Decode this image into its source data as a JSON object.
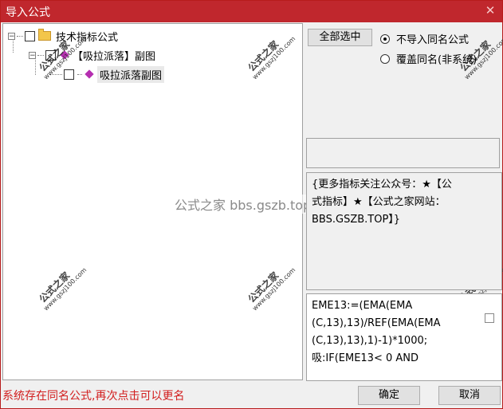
{
  "window": {
    "title": "导入公式",
    "close_glyph": "✕"
  },
  "tree": {
    "root_label": "技术指标公式",
    "child_label": "【吸拉派落】副图",
    "leaf_label": "吸拉派落副图"
  },
  "options": {
    "select_all_label": "全部选中",
    "radio_skip_label": "不导入同名公式",
    "radio_overwrite_label": "覆盖同名(非系统)",
    "selected_option": "不导入同名公式"
  },
  "description": {
    "lines": [
      "{更多指标关注公众号：★【公",
      "式指标】★【公式之家网站：",
      "BBS.GSZB.TOP】}"
    ]
  },
  "code": {
    "lines": [
      "EME13:=(EMA(EMA",
      "(C,13),13)/REF(EMA(EMA",
      "(C,13),13),1)-1)*1000;",
      "吸:IF(EME13< 0 AND"
    ]
  },
  "status_text": "系统存在同名公式,再次点击可以更名",
  "buttons": {
    "ok_label": "确定",
    "cancel_label": "取消"
  },
  "watermark": {
    "center_text": "公式之家 bbs.gszb.top",
    "logo_text": "公式之家",
    "logo_url": "www.gszj100.com"
  }
}
